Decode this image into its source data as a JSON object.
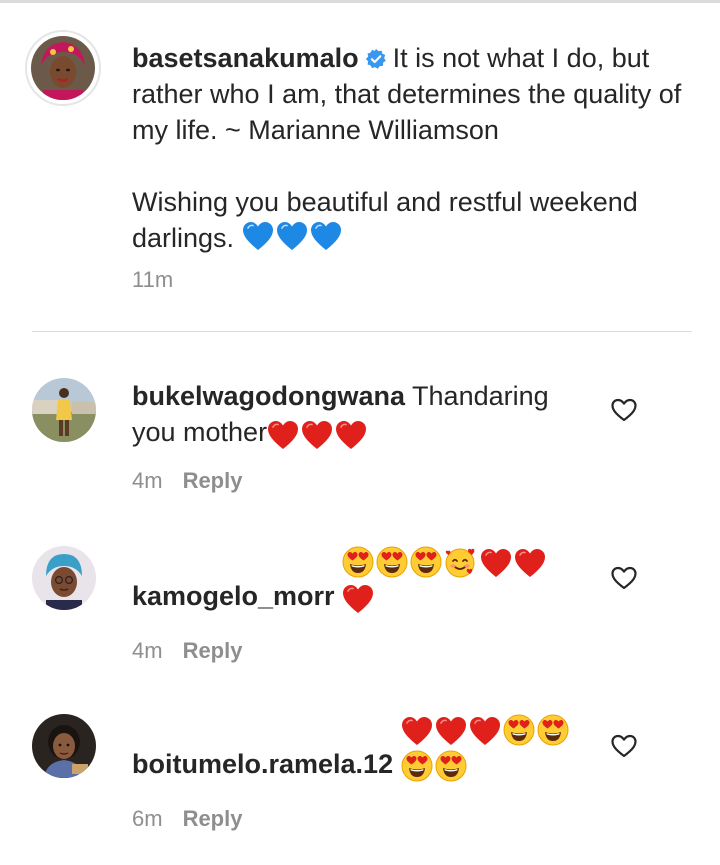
{
  "post": {
    "username": "basetsanakumalo",
    "caption_line1": "It is not what I do, but rather who I am, that determines the quality of my life. ~ Marianne Williamson",
    "caption_line2": "Wishing you beautiful and restful weekend darlings.",
    "time": "11m"
  },
  "comments": [
    {
      "username": "bukelwagodongwana",
      "text": "Thandaring you mother",
      "time": "4m",
      "reply_label": "Reply"
    },
    {
      "username": "kamogelo_morr",
      "text": "",
      "time": "4m",
      "reply_label": "Reply"
    },
    {
      "username": "boitumelo.ramela.12",
      "text": "",
      "time": "6m",
      "reply_label": "Reply"
    }
  ],
  "icons": {
    "verified": "verified-badge-icon",
    "like": "heart-outline-icon",
    "emojis": [
      "blue-heart",
      "red-heart",
      "heart-eyes-face",
      "smiling-face-with-hearts"
    ]
  },
  "colors": {
    "verified_blue": "#3897f0",
    "blue_heart": "#1e88e5",
    "red_heart": "#e0201b",
    "muted_text": "#8e8e8e",
    "divider": "#dbdbdb"
  }
}
